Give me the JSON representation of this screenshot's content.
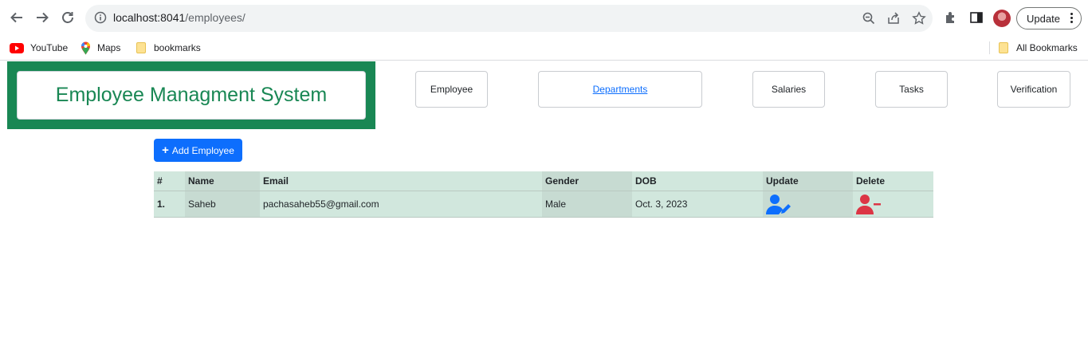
{
  "browser": {
    "url_host": "localhost:8041",
    "url_path": "/employees/",
    "update_label": "Update",
    "bookmarks": [
      {
        "label": "YouTube",
        "icon": "youtube-icon"
      },
      {
        "label": "Maps",
        "icon": "maps-icon"
      },
      {
        "label": "bookmarks",
        "icon": "folder-icon"
      }
    ],
    "all_bookmarks_label": "All Bookmarks"
  },
  "brand": {
    "title": "Employee Managment System",
    "color": "#198754"
  },
  "nav": [
    {
      "label": "Employee",
      "active": false
    },
    {
      "label": "Departments",
      "active": true
    },
    {
      "label": "Salaries",
      "active": false
    },
    {
      "label": "Tasks",
      "active": false
    },
    {
      "label": "Verification",
      "active": false
    }
  ],
  "actions": {
    "add_employee_label": "Add Employee"
  },
  "table": {
    "headers": [
      "#",
      "Name",
      "Email",
      "Gender",
      "DOB",
      "Update",
      "Delete"
    ],
    "rows": [
      {
        "num": "1.",
        "name": "Saheb",
        "email": "pachasaheb55@gmail.com",
        "gender": "Male",
        "dob": "Oct. 3, 2023"
      }
    ]
  },
  "colors": {
    "primary": "#0d6efd",
    "success": "#198754",
    "danger": "#dc3545",
    "table_bg": "#d1e7dd"
  }
}
